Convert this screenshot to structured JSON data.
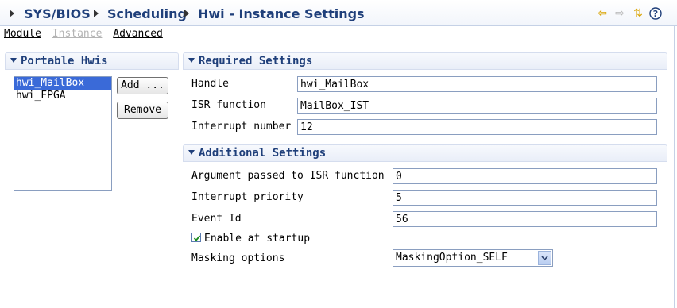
{
  "breadcrumb": {
    "items": [
      "SYS/BIOS",
      "Scheduling",
      "Hwi - Instance Settings"
    ]
  },
  "toolbar_icons": [
    "back-arrow-icon",
    "forward-arrow-icon",
    "sync-icon",
    "help-icon"
  ],
  "tabs": [
    {
      "label": "Module",
      "enabled": true
    },
    {
      "label": "Instance",
      "enabled": false
    },
    {
      "label": "Advanced",
      "enabled": true
    }
  ],
  "portable": {
    "title": "Portable Hwis",
    "items": [
      "hwi_MailBox",
      "hwi_FPGA"
    ],
    "selected_index": 0,
    "add_label": "Add ...",
    "remove_label": "Remove"
  },
  "required": {
    "title": "Required Settings",
    "handle_label": "Handle",
    "handle_value": "hwi_MailBox",
    "isr_label": "ISR function",
    "isr_value": "MailBox_IST",
    "intnum_label": "Interrupt number",
    "intnum_value": "12"
  },
  "additional": {
    "title": "Additional Settings",
    "arg_label": "Argument passed to ISR function",
    "arg_value": "0",
    "priority_label": "Interrupt priority",
    "priority_value": "5",
    "eventid_label": "Event Id",
    "eventid_value": "56",
    "enable_label": "Enable at startup",
    "enable_checked": true,
    "masking_label": "Masking options",
    "masking_value": "MaskingOption_SELF"
  },
  "colors": {
    "accent": "#1f3f7a",
    "selection": "#3a6ad8"
  }
}
